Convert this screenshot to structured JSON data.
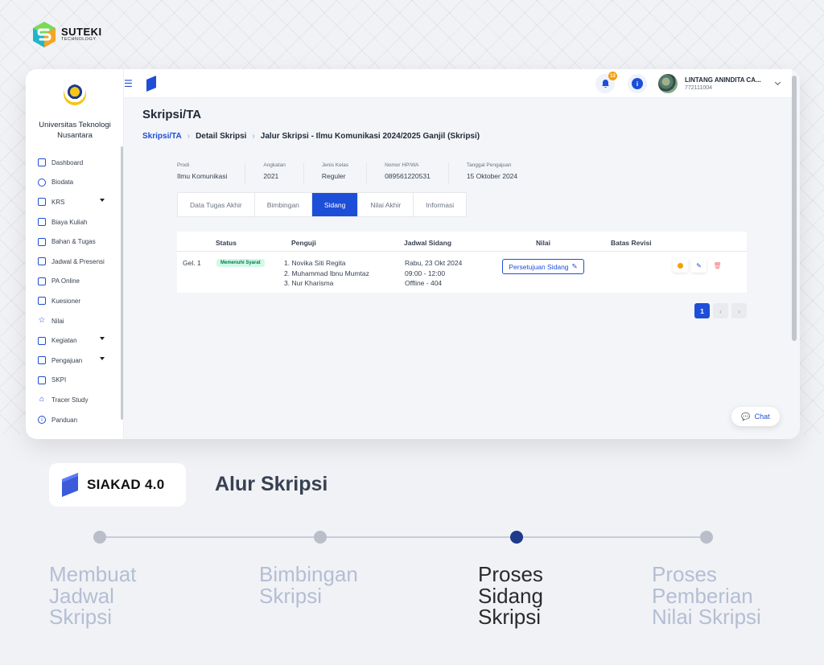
{
  "brand": {
    "name": "SUTEKI",
    "sub": "TECHNOLOGY"
  },
  "sidebar": {
    "uni_name": "Universitas Teknologi Nusantara",
    "items": [
      {
        "label": "Dashboard",
        "icon": "dashboard-icon"
      },
      {
        "label": "Biodata",
        "icon": "database-icon"
      },
      {
        "label": "KRS",
        "icon": "folder-icon",
        "caret": true
      },
      {
        "label": "Biaya Kuliah",
        "icon": "card-icon"
      },
      {
        "label": "Bahan & Tugas",
        "icon": "bookmark-icon"
      },
      {
        "label": "Jadwal & Presensi",
        "icon": "calendar-icon"
      },
      {
        "label": "PA Online",
        "icon": "chat-icon"
      },
      {
        "label": "Kuesioner",
        "icon": "edit-icon"
      },
      {
        "label": "Nilai",
        "icon": "star-icon"
      },
      {
        "label": "Kegiatan",
        "icon": "activity-icon",
        "caret": true
      },
      {
        "label": "Pengajuan",
        "icon": "folder-icon",
        "caret": true
      },
      {
        "label": "SKPI",
        "icon": "document-icon"
      },
      {
        "label": "Tracer Study",
        "icon": "graduation-icon"
      },
      {
        "label": "Panduan",
        "icon": "info-icon"
      }
    ]
  },
  "topbar": {
    "notifications": "13",
    "info": "i",
    "user_name": "LINTANG ANINDITA CA...",
    "user_id": "772111004"
  },
  "page": {
    "title": "Skripsi/TA",
    "breadcrumbs": [
      "Skripsi/TA",
      "Detail Skripsi",
      "Jalur Skripsi - Ilmu Komunikasi 2024/2025 Ganjil (Skripsi)"
    ]
  },
  "details": [
    {
      "label": "Prodi",
      "value": "Ilmu Komunikasi"
    },
    {
      "label": "Angkatan",
      "value": "2021"
    },
    {
      "label": "Jenis Kelas",
      "value": "Reguler"
    },
    {
      "label": "Nomor HP/WA",
      "value": "089561220531"
    },
    {
      "label": "Tanggal Pengajuan",
      "value": "15 Oktober 2024"
    }
  ],
  "tabs": [
    "Data Tugas Akhir",
    "Bimbingan",
    "Sidang",
    "Nilai Akhir",
    "Informasi"
  ],
  "active_tab": "Sidang",
  "table": {
    "headers": [
      "Status",
      "Penguji",
      "Jadwal Sidang",
      "Nilai",
      "Batas Revisi"
    ],
    "row": {
      "gel": "Gel. 1",
      "status": "Memenuhi Syarat",
      "penguji": [
        "1. Novika Siti Regita",
        "2. Muhammad Ibnu Mumtaz",
        "3. Nur Kharisma"
      ],
      "jadwal": [
        "Rabu, 23 Okt 2024",
        "09:00 - 12:00",
        "Offline - 404"
      ],
      "nilai_button": "Persetujuan Sidang"
    }
  },
  "pagination": {
    "current": "1"
  },
  "chat": {
    "label": "Chat"
  },
  "product": {
    "name": "SIAKAD 4.0"
  },
  "section_title": "Alur Skripsi",
  "timeline": {
    "steps": [
      "Membuat\nJadwal\nSkripsi",
      "Bimbingan\nSkripsi",
      "Proses\nSidang\nSkripsi",
      "Proses\nPemberian\nNilai Skripsi"
    ],
    "active_index": 2
  },
  "colors": {
    "primary": "#1d4ed8",
    "active_step": "#1e3a8a",
    "inactive_step": "#b4bed3"
  }
}
